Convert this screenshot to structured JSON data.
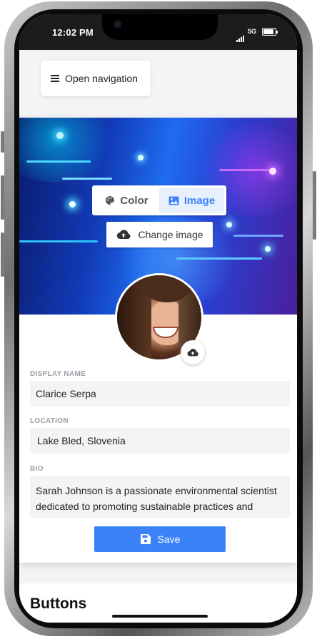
{
  "status_bar": {
    "time": "12:02 PM",
    "network": "5G"
  },
  "nav": {
    "open_navigation_label": "Open navigation"
  },
  "profile": {
    "background_tabs": [
      {
        "label": "Color",
        "icon": "palette-icon",
        "active": false
      },
      {
        "label": "Image",
        "icon": "image-icon",
        "active": true
      }
    ],
    "change_image_label": "Change image",
    "fields": {
      "display_name": {
        "label": "DISPLAY NAME",
        "value": "Clarice Serpa"
      },
      "location": {
        "label": "LOCATION",
        "value": "Lake Bled, Slovenia"
      },
      "bio": {
        "label": "BIO",
        "value": "Sarah Johnson is a passionate environmental scientist dedicated to promoting sustainable practices and conservation efforts."
      }
    },
    "save_label": "Save"
  },
  "sections": {
    "buttons_title": "Buttons"
  },
  "colors": {
    "accent": "#3b82f6",
    "active_tab_bg": "#e8f0fd",
    "field_bg": "#f3f4f6",
    "label": "#9aa0a8"
  }
}
